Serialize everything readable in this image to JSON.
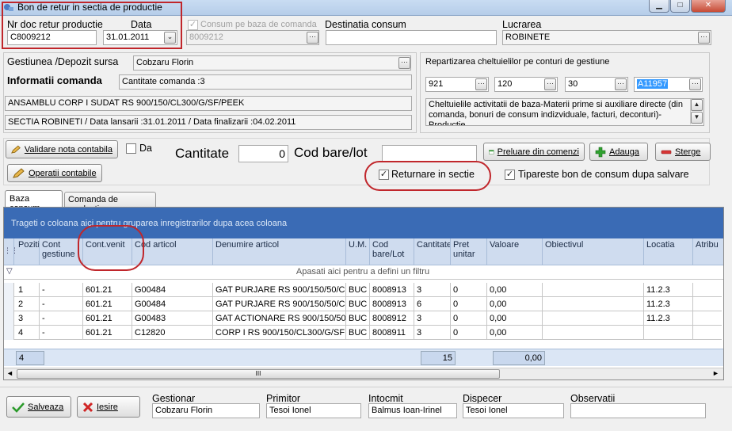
{
  "window": {
    "title": "Bon de retur in sectia de productie",
    "minimize": "▁",
    "maximize": "□",
    "close": "✕"
  },
  "header": {
    "doc_label": "Nr doc retur productie",
    "doc_value": "C8009212",
    "date_label": "Data",
    "date_value": "31.01.2011",
    "consum_label": "Consum pe baza de comanda",
    "consum_value": "8009212",
    "destinatia_label": "Destinatia consum",
    "destinatia_value": "",
    "lucrarea_label": "Lucrarea",
    "lucrarea_value": "ROBINETE"
  },
  "source": {
    "gestiune_label": "Gestiunea /Depozit sursa",
    "gestiune_value": "Cobzaru Florin",
    "info_label": "Informatii comanda",
    "cantitate_comanda": "Cantitate comanda :3",
    "ansamblu": "ANSAMBLU CORP I SUDAT RS 900/150/CL300/G/SF/PEEK",
    "sectia": "SECTIA ROBINETI / Data lansarii :31.01.2011 / Data finalizarii :04.02.2011"
  },
  "repartizare": {
    "label": "Repartizarea cheltuielilor pe conturi de gestiune",
    "acc1": "921",
    "acc2": "120",
    "acc3": "30",
    "acc4": "A11957",
    "description": "Cheltuielile activitatii de baza-Materii prime si auxiliare directe (din comanda, bonuri de consum indizviduale, facturi, deconturi)-Productie"
  },
  "toolbar": {
    "validare": "Validare nota contabila",
    "da": "Da",
    "operatii": "Operatii contabile",
    "cantitate_label": "Cantitate",
    "cantitate_value": "0",
    "cod_label": "Cod bare/lot",
    "cod_value": "",
    "preluare": "Preluare din comenzi",
    "adauga": "Adauga",
    "sterge": "Sterge",
    "returnare": "Returnare in sectie",
    "tipareste": "Tipareste bon de consum dupa salvare"
  },
  "tabs": [
    "Baza consum",
    "Comanda de productie"
  ],
  "grid": {
    "group_hint": "Trageti o coloana aici pentru gruparea inregistrarilor dupa acea coloana",
    "filter_hint": "Apasati aici pentru a defini un filtru",
    "columns": [
      "Pozitia",
      "Cont gestiune",
      "Cont.venit",
      "Cod articol",
      "Denumire articol",
      "U.M.",
      "Cod bare/Lot",
      "Cantitate",
      "Pret unitar",
      "Valoare",
      "Obiectivul",
      "Locatia",
      "Atribu"
    ],
    "rows": [
      [
        "1",
        "-",
        "601.21",
        "G00484",
        "GAT PURJARE RS 900/150/50/C",
        "BUC",
        "8008913",
        "3",
        "0",
        "0,00",
        "",
        "11.2.3",
        ""
      ],
      [
        "2",
        "-",
        "601.21",
        "G00484",
        "GAT PURJARE RS 900/150/50/C",
        "BUC",
        "8008913",
        "6",
        "0",
        "0,00",
        "",
        "11.2.3",
        ""
      ],
      [
        "3",
        "-",
        "601.21",
        "G00483",
        "GAT ACTIONARE RS 900/150/50/",
        "BUC",
        "8008912",
        "3",
        "0",
        "0,00",
        "",
        "11.2.3",
        ""
      ],
      [
        "4",
        "-",
        "601.21",
        "C12820",
        "CORP I RS 900/150/CL300/G/SF",
        "BUC",
        "8008911",
        "3",
        "0",
        "0,00",
        "",
        "",
        ""
      ]
    ],
    "footer_count": "4",
    "footer_cantitate": "15",
    "footer_valoare": "0,00",
    "scroll_grip": "III"
  },
  "bottom": {
    "salveaza": "Salveaza",
    "iesire": "Iesire",
    "gestionar_label": "Gestionar",
    "gestionar_value": "Cobzaru Florin",
    "primitor_label": "Primitor",
    "primitor_value": "Tesoi Ionel",
    "intocmit_label": "Intocmit",
    "intocmit_value": "Balmus Ioan-Irinel",
    "dispecer_label": "Dispecer",
    "dispecer_value": "Tesoi Ionel",
    "observatii_label": "Observatii",
    "observatii_value": ""
  },
  "colors": {
    "grid_header_bg": "#cfdcef",
    "group_bar_bg": "#3a6bb5",
    "footer_bg": "#dbe6f5",
    "highlight_red": "#c0262b",
    "selected_field_bg": "#3399ff"
  },
  "icons": {
    "validare": "pencil-icon",
    "operatii": "pencil-icon",
    "preluare": "window-icon",
    "adauga": "plus-icon",
    "sterge": "minus-icon",
    "salveaza": "checkmark-icon",
    "iesire": "x-icon"
  }
}
